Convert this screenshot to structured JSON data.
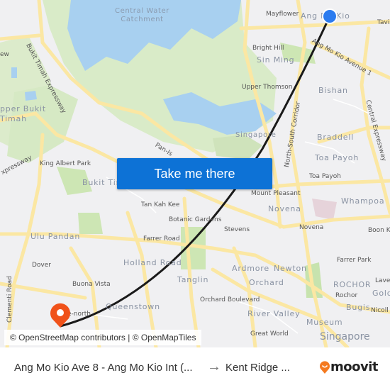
{
  "map": {
    "labels": {
      "central_water_catchment": "Central Water\nCatchment",
      "bukit_timah_expressway": "Bukit Timah Expressway",
      "upper_bukit_timah": "pper Bukit\nTimah",
      "mayflower": "Mayflower",
      "ang_mo_kio": "Ang Mo Kio",
      "tavistock": "Tavis",
      "bright_hill": "Bright Hill",
      "sin_ming": "Sin Ming",
      "ang_mo_kio_avenue_1": "Ang Mo Kio Avenue 1",
      "upper_thomson": "Upper Thomson",
      "bishan": "Bishan",
      "central_expressway": "Central Expressway",
      "north_south_corridor": "North-South Corridor",
      "singapore_island": "Singapore",
      "braddell": "Braddell",
      "toa_payoh_area": "Toa Payoh",
      "toa_payoh_road": "Toa Payoh",
      "pan_island": "Pan-Is",
      "king_albert_park": "King Albert Park",
      "expressway_left": "xpressway",
      "bukit_timah": "Bukit Timah",
      "mount_pleasant": "Mount Pleasant",
      "novena_area": "Novena",
      "whampoa": "Whampoa",
      "tan_kah_kee": "Tan Kah Kee",
      "botanic_gardens": "Botanic Gardens",
      "stevens": "Stevens",
      "novena_stn": "Novena",
      "boon_keng": "Boon Ke",
      "ulu_pandan": "Ulu Pandan",
      "farrer_road": "Farrer Road",
      "holland_road": "Holland Road",
      "farrer_park": "Farrer Park",
      "ardmore": "Ardmore",
      "newton": "Newton",
      "dover": "Dover",
      "buona_vista": "Buona Vista",
      "tanglin": "Tanglin",
      "orchard": "Orchard",
      "rochor_area": "ROCHOR",
      "rochor": "Rochor",
      "lavender": "Lavei",
      "golden": "Gold",
      "clementi_road": "Clementi Road",
      "queenstown": "Queenstown",
      "orchard_boulevard": "Orchard Boulevard",
      "bugis": "Bugis",
      "nicoll": "Nicoll I",
      "one_north": "e-north",
      "river_valley": "River Valley",
      "museum": "Museum",
      "great_world": "Great World",
      "singapore_city": "Singapore",
      "view": "ew"
    },
    "origin_marker": {
      "name": "Ang Mo Kio Ave 8 - Ang Mo Kio Int",
      "color": "#2b7bef"
    },
    "destination_marker": {
      "name": "Kent Ridge",
      "color": "#f0521a"
    },
    "route_color": "#1a1a1a"
  },
  "cta": {
    "label": "Take me there",
    "color": "#0d72d6"
  },
  "attribution": "© OpenStreetMap contributors | © OpenMapTiles",
  "footer": {
    "from": "Ang Mo Kio Ave 8 - Ang Mo Kio Int (...",
    "arrow": "→",
    "to": "Kent Ridge ...",
    "brand": "moovit",
    "brand_color": "#f47a20"
  }
}
